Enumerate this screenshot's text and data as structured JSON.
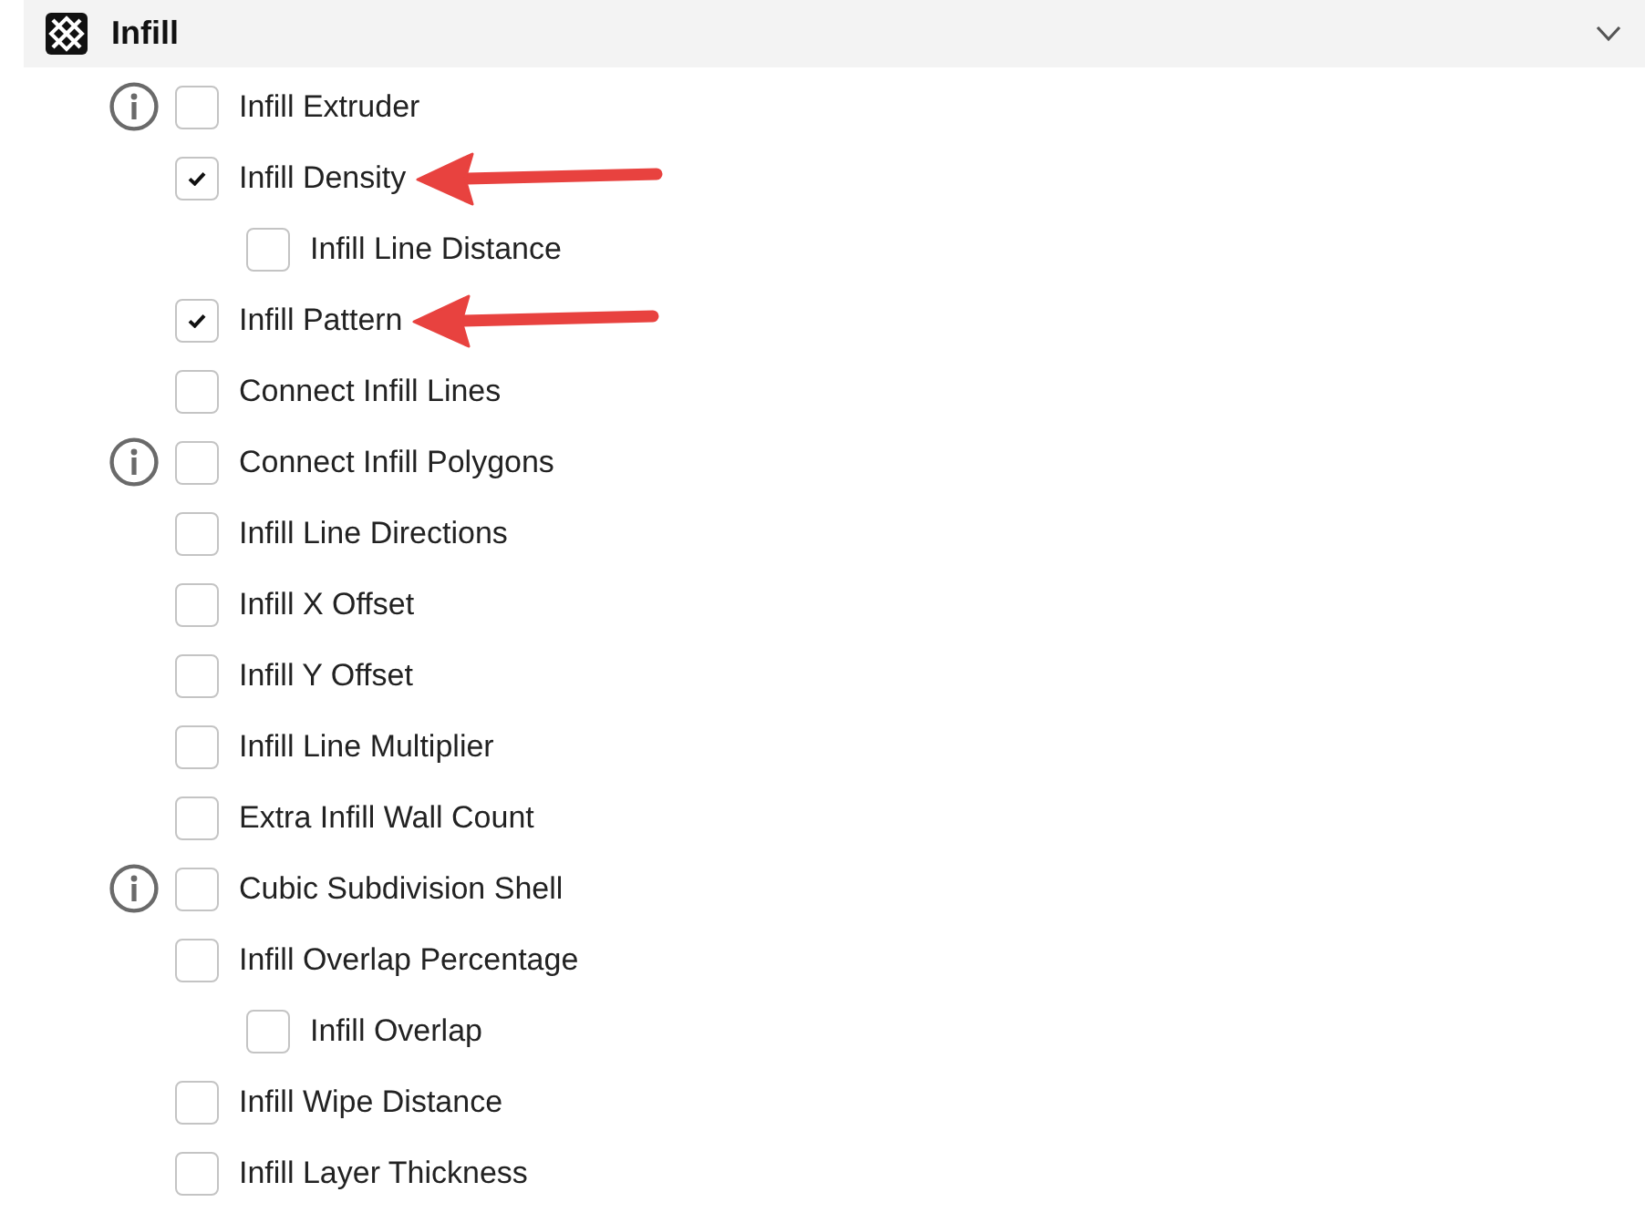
{
  "section": {
    "title": "Infill",
    "expanded": true
  },
  "settings": [
    {
      "label": "Infill Extruder",
      "checked": false,
      "info": true,
      "arrow": false
    },
    {
      "label": "Infill Density",
      "checked": true,
      "info": false,
      "arrow": true,
      "children": [
        {
          "label": "Infill Line Distance",
          "checked": false,
          "info": false,
          "arrow": false
        }
      ]
    },
    {
      "label": "Infill Pattern",
      "checked": true,
      "info": false,
      "arrow": true
    },
    {
      "label": "Connect Infill Lines",
      "checked": false,
      "info": false,
      "arrow": false
    },
    {
      "label": "Connect Infill Polygons",
      "checked": false,
      "info": true,
      "arrow": false
    },
    {
      "label": "Infill Line Directions",
      "checked": false,
      "info": false,
      "arrow": false
    },
    {
      "label": "Infill X Offset",
      "checked": false,
      "info": false,
      "arrow": false
    },
    {
      "label": "Infill Y Offset",
      "checked": false,
      "info": false,
      "arrow": false
    },
    {
      "label": "Infill Line Multiplier",
      "checked": false,
      "info": false,
      "arrow": false
    },
    {
      "label": "Extra Infill Wall Count",
      "checked": false,
      "info": false,
      "arrow": false
    },
    {
      "label": "Cubic Subdivision Shell",
      "checked": false,
      "info": true,
      "arrow": false
    },
    {
      "label": "Infill Overlap Percentage",
      "checked": false,
      "info": false,
      "arrow": false,
      "children": [
        {
          "label": "Infill Overlap",
          "checked": false,
          "info": false,
          "arrow": false
        }
      ]
    },
    {
      "label": "Infill Wipe Distance",
      "checked": false,
      "info": false,
      "arrow": false
    },
    {
      "label": "Infill Layer Thickness",
      "checked": false,
      "info": false,
      "arrow": false
    }
  ]
}
